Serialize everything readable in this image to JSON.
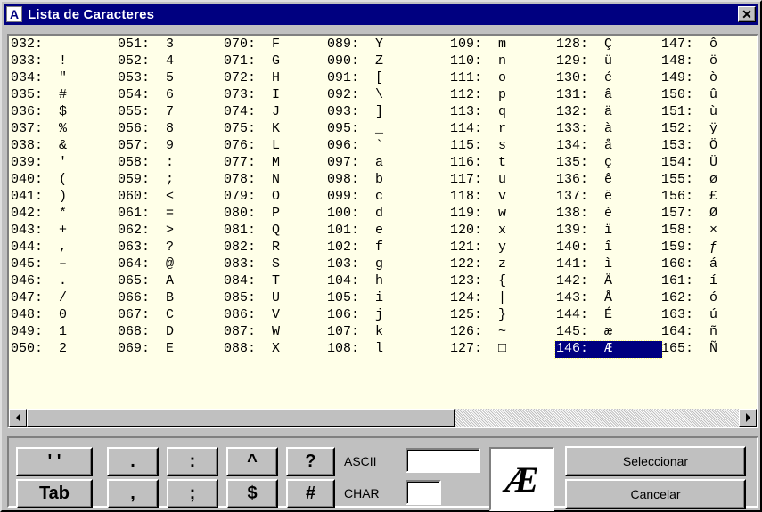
{
  "window": {
    "title": "Lista de Caracteres",
    "app_icon": "A",
    "close_glyph": "✕"
  },
  "character_list": {
    "selected_code": "146",
    "columns": [
      [
        {
          "code": "032",
          "char": " "
        },
        {
          "code": "033",
          "char": "!"
        },
        {
          "code": "034",
          "char": "\""
        },
        {
          "code": "035",
          "char": "#"
        },
        {
          "code": "036",
          "char": "$"
        },
        {
          "code": "037",
          "char": "%"
        },
        {
          "code": "038",
          "char": "&"
        },
        {
          "code": "039",
          "char": "'"
        },
        {
          "code": "040",
          "char": "("
        },
        {
          "code": "041",
          "char": ")"
        },
        {
          "code": "042",
          "char": "*"
        },
        {
          "code": "043",
          "char": "+"
        },
        {
          "code": "044",
          "char": ","
        },
        {
          "code": "045",
          "char": "–"
        },
        {
          "code": "046",
          "char": "."
        },
        {
          "code": "047",
          "char": "/"
        },
        {
          "code": "048",
          "char": "0"
        },
        {
          "code": "049",
          "char": "1"
        },
        {
          "code": "050",
          "char": "2"
        }
      ],
      [
        {
          "code": "051",
          "char": "3"
        },
        {
          "code": "052",
          "char": "4"
        },
        {
          "code": "053",
          "char": "5"
        },
        {
          "code": "054",
          "char": "6"
        },
        {
          "code": "055",
          "char": "7"
        },
        {
          "code": "056",
          "char": "8"
        },
        {
          "code": "057",
          "char": "9"
        },
        {
          "code": "058",
          "char": ":"
        },
        {
          "code": "059",
          "char": ";"
        },
        {
          "code": "060",
          "char": "<"
        },
        {
          "code": "061",
          "char": "="
        },
        {
          "code": "062",
          "char": ">"
        },
        {
          "code": "063",
          "char": "?"
        },
        {
          "code": "064",
          "char": "@"
        },
        {
          "code": "065",
          "char": "A"
        },
        {
          "code": "066",
          "char": "B"
        },
        {
          "code": "067",
          "char": "C"
        },
        {
          "code": "068",
          "char": "D"
        },
        {
          "code": "069",
          "char": "E"
        }
      ],
      [
        {
          "code": "070",
          "char": "F"
        },
        {
          "code": "071",
          "char": "G"
        },
        {
          "code": "072",
          "char": "H"
        },
        {
          "code": "073",
          "char": "I"
        },
        {
          "code": "074",
          "char": "J"
        },
        {
          "code": "075",
          "char": "K"
        },
        {
          "code": "076",
          "char": "L"
        },
        {
          "code": "077",
          "char": "M"
        },
        {
          "code": "078",
          "char": "N"
        },
        {
          "code": "079",
          "char": "O"
        },
        {
          "code": "080",
          "char": "P"
        },
        {
          "code": "081",
          "char": "Q"
        },
        {
          "code": "082",
          "char": "R"
        },
        {
          "code": "083",
          "char": "S"
        },
        {
          "code": "084",
          "char": "T"
        },
        {
          "code": "085",
          "char": "U"
        },
        {
          "code": "086",
          "char": "V"
        },
        {
          "code": "087",
          "char": "W"
        },
        {
          "code": "088",
          "char": "X"
        }
      ],
      [
        {
          "code": "089",
          "char": "Y"
        },
        {
          "code": "090",
          "char": "Z"
        },
        {
          "code": "091",
          "char": "["
        },
        {
          "code": "092",
          "char": "\\"
        },
        {
          "code": "093",
          "char": "]"
        },
        {
          "code": "095",
          "char": "_"
        },
        {
          "code": "096",
          "char": "`"
        },
        {
          "code": "097",
          "char": "a"
        },
        {
          "code": "098",
          "char": "b"
        },
        {
          "code": "099",
          "char": "c"
        },
        {
          "code": "100",
          "char": "d"
        },
        {
          "code": "101",
          "char": "e"
        },
        {
          "code": "102",
          "char": "f"
        },
        {
          "code": "103",
          "char": "g"
        },
        {
          "code": "104",
          "char": "h"
        },
        {
          "code": "105",
          "char": "i"
        },
        {
          "code": "106",
          "char": "j"
        },
        {
          "code": "107",
          "char": "k"
        },
        {
          "code": "108",
          "char": "l"
        }
      ],
      [
        {
          "code": "109",
          "char": "m"
        },
        {
          "code": "110",
          "char": "n"
        },
        {
          "code": "111",
          "char": "o"
        },
        {
          "code": "112",
          "char": "p"
        },
        {
          "code": "113",
          "char": "q"
        },
        {
          "code": "114",
          "char": "r"
        },
        {
          "code": "115",
          "char": "s"
        },
        {
          "code": "116",
          "char": "t"
        },
        {
          "code": "117",
          "char": "u"
        },
        {
          "code": "118",
          "char": "v"
        },
        {
          "code": "119",
          "char": "w"
        },
        {
          "code": "120",
          "char": "x"
        },
        {
          "code": "121",
          "char": "y"
        },
        {
          "code": "122",
          "char": "z"
        },
        {
          "code": "123",
          "char": "{"
        },
        {
          "code": "124",
          "char": "|"
        },
        {
          "code": "125",
          "char": "}"
        },
        {
          "code": "126",
          "char": "~"
        },
        {
          "code": "127",
          "char": "□"
        }
      ],
      [
        {
          "code": "128",
          "char": "Ç"
        },
        {
          "code": "129",
          "char": "ü"
        },
        {
          "code": "130",
          "char": "é"
        },
        {
          "code": "131",
          "char": "â"
        },
        {
          "code": "132",
          "char": "ä"
        },
        {
          "code": "133",
          "char": "à"
        },
        {
          "code": "134",
          "char": "å"
        },
        {
          "code": "135",
          "char": "ç"
        },
        {
          "code": "136",
          "char": "ê"
        },
        {
          "code": "137",
          "char": "ë"
        },
        {
          "code": "138",
          "char": "è"
        },
        {
          "code": "139",
          "char": "ï"
        },
        {
          "code": "140",
          "char": "î"
        },
        {
          "code": "141",
          "char": "ì"
        },
        {
          "code": "142",
          "char": "Ä"
        },
        {
          "code": "143",
          "char": "Å"
        },
        {
          "code": "144",
          "char": "É"
        },
        {
          "code": "145",
          "char": "æ"
        },
        {
          "code": "146",
          "char": "Æ"
        }
      ],
      [
        {
          "code": "147",
          "char": "ô"
        },
        {
          "code": "148",
          "char": "ö"
        },
        {
          "code": "149",
          "char": "ò"
        },
        {
          "code": "150",
          "char": "û"
        },
        {
          "code": "151",
          "char": "ù"
        },
        {
          "code": "152",
          "char": "ÿ"
        },
        {
          "code": "153",
          "char": "Ö"
        },
        {
          "code": "154",
          "char": "Ü"
        },
        {
          "code": "155",
          "char": "ø"
        },
        {
          "code": "156",
          "char": "£"
        },
        {
          "code": "157",
          "char": "Ø"
        },
        {
          "code": "158",
          "char": "×"
        },
        {
          "code": "159",
          "char": "ƒ"
        },
        {
          "code": "160",
          "char": "á"
        },
        {
          "code": "161",
          "char": "í"
        },
        {
          "code": "162",
          "char": "ó"
        },
        {
          "code": "163",
          "char": "ú"
        },
        {
          "code": "164",
          "char": "ñ"
        },
        {
          "code": "165",
          "char": "Ñ"
        }
      ]
    ]
  },
  "quick_buttons": {
    "row1": [
      "' '",
      ".",
      ":",
      "^",
      "?"
    ],
    "row2": [
      "Tab",
      ",",
      ";",
      "$",
      "#"
    ]
  },
  "fields": {
    "ascii_label": "ASCII",
    "ascii_value": "",
    "char_label": "CHAR",
    "char_value": ""
  },
  "preview": {
    "char": "Æ"
  },
  "actions": {
    "select_label": "Seleccionar",
    "cancel_label": "Cancelar"
  }
}
